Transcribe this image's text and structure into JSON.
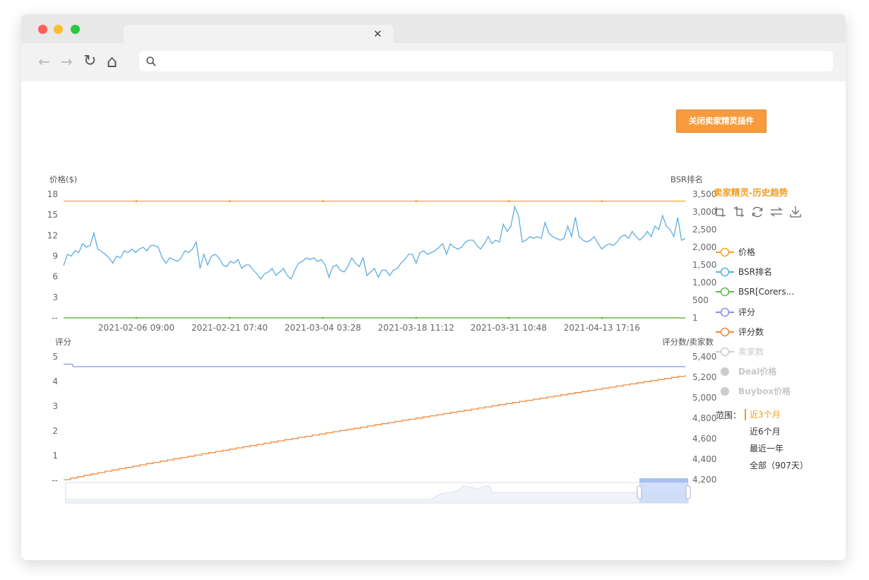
{
  "browser": {
    "tab_close": "✕",
    "nav": {
      "back": "←",
      "forward": "→",
      "reload": "↻",
      "home": "⌂"
    },
    "url": ""
  },
  "plugin": {
    "close_button": "关闭卖家精灵插件"
  },
  "legend": {
    "title": "卖家精灵-历史趋势",
    "tools": [
      "zoom-icon",
      "zoom-reset-icon",
      "refresh-icon",
      "switch-icon",
      "download-icon"
    ],
    "items": [
      {
        "label": "价格",
        "color": "#f5a623",
        "active": true,
        "marker": "line"
      },
      {
        "label": "BSR排名",
        "color": "#5dade2",
        "active": true,
        "marker": "line"
      },
      {
        "label": "BSR[Corers...",
        "color": "#66bb4a",
        "active": true,
        "marker": "line"
      },
      {
        "label": "评分",
        "color": "#8c8fe6",
        "active": true,
        "marker": "line"
      },
      {
        "label": "评分数",
        "color": "#f08a3c",
        "active": true,
        "marker": "line"
      },
      {
        "label": "卖家数",
        "color": "#cccccc",
        "active": false,
        "marker": "line"
      },
      {
        "label": "Deal价格",
        "color": "#cccccc",
        "active": false,
        "marker": "dot"
      },
      {
        "label": "Buybox价格",
        "color": "#cccccc",
        "active": false,
        "marker": "dot"
      }
    ],
    "range_label": "范围：",
    "range_options": [
      {
        "label": "近3个月",
        "selected": true
      },
      {
        "label": "近6个月",
        "selected": false
      },
      {
        "label": "最近一年",
        "selected": false
      },
      {
        "label": "全部（907天）",
        "selected": false
      }
    ],
    "accent": "#f39c1f"
  },
  "chart_data": [
    {
      "type": "line",
      "left_axis_label": "价格($)",
      "right_axis_label": "BSR排名",
      "left_ticks": [
        "18",
        "15",
        "12",
        "9",
        "6",
        "3",
        "--"
      ],
      "right_ticks": [
        "3,500",
        "3,000",
        "2,500",
        "2,000",
        "1,500",
        "1,000",
        "500",
        "1"
      ],
      "x_ticks": [
        "2021-02-06 09:00",
        "2021-02-21 07:40",
        "2021-03-04 03:28",
        "2021-03-18 11:12",
        "2021-03-31 10:48",
        "2021-04-13 17:16"
      ],
      "series": [
        {
          "name": "价格",
          "axis": "left",
          "color": "#f5a623",
          "constant": 17.0
        },
        {
          "name": "BSR排名",
          "axis": "right",
          "color": "#5dade2",
          "values": [
            1480,
            1800,
            1750,
            1900,
            1850,
            2100,
            2000,
            2050,
            2400,
            1950,
            1880,
            1800,
            1700,
            1550,
            1750,
            1700,
            1900,
            1850,
            1950,
            1850,
            1950,
            2000,
            1900,
            2050,
            2050,
            2000,
            1700,
            1550,
            1700,
            1650,
            1600,
            1700,
            1900,
            1850,
            1950,
            2150,
            1400,
            1800,
            1500,
            1750,
            1800,
            1700,
            1500,
            1450,
            1600,
            1550,
            1650,
            1400,
            1500,
            1500,
            1350,
            1250,
            1100,
            1250,
            1300,
            1400,
            1200,
            1300,
            1400,
            1200,
            1100,
            1350,
            1550,
            1600,
            1700,
            1650,
            1700,
            1600,
            1650,
            1500,
            1150,
            1450,
            1500,
            1350,
            1300,
            1450,
            1700,
            1550,
            1450,
            1700,
            1200,
            1300,
            1400,
            1150,
            1350,
            1350,
            1200,
            1350,
            1400,
            1550,
            1650,
            1800,
            1800,
            1550,
            1850,
            1900,
            1800,
            1850,
            1900,
            2000,
            2100,
            1800,
            2100,
            2000,
            1950,
            2000,
            2150,
            2200,
            2200,
            2050,
            1950,
            2100,
            2300,
            2100,
            2200,
            2150,
            2650,
            2450,
            2600,
            3150,
            2900,
            2150,
            2200,
            2300,
            2250,
            2300,
            2250,
            2700,
            2400,
            2300,
            2250,
            2200,
            2250,
            2600,
            2300,
            2850,
            2300,
            2200,
            2150,
            2200,
            2300,
            2100,
            1950,
            2050,
            2100,
            2050,
            2150,
            2300,
            2350,
            2250,
            2450,
            2300,
            2200,
            2300,
            2450,
            2300,
            2600,
            2500,
            2900,
            2600,
            2500,
            2300,
            2850,
            2200,
            2250
          ]
        },
        {
          "name": "BSR[Corers...",
          "axis": "right",
          "color": "#66bb4a",
          "constant": 1
        }
      ]
    },
    {
      "type": "line",
      "left_axis_label": "评分",
      "right_axis_label": "评分数/卖家数",
      "left_ticks": [
        "5",
        "4",
        "3",
        "2",
        "1",
        "--"
      ],
      "right_ticks": [
        "5,400",
        "5,200",
        "5,000",
        "4,800",
        "4,600",
        "4,400",
        "4,200"
      ],
      "series": [
        {
          "name": "评分",
          "axis": "left",
          "color": "#8c8fe6",
          "start": 4.7,
          "end": 4.6
        },
        {
          "name": "评分数",
          "axis": "right",
          "color": "#f08a3c",
          "start": 4200,
          "end": 5220
        }
      ]
    }
  ]
}
